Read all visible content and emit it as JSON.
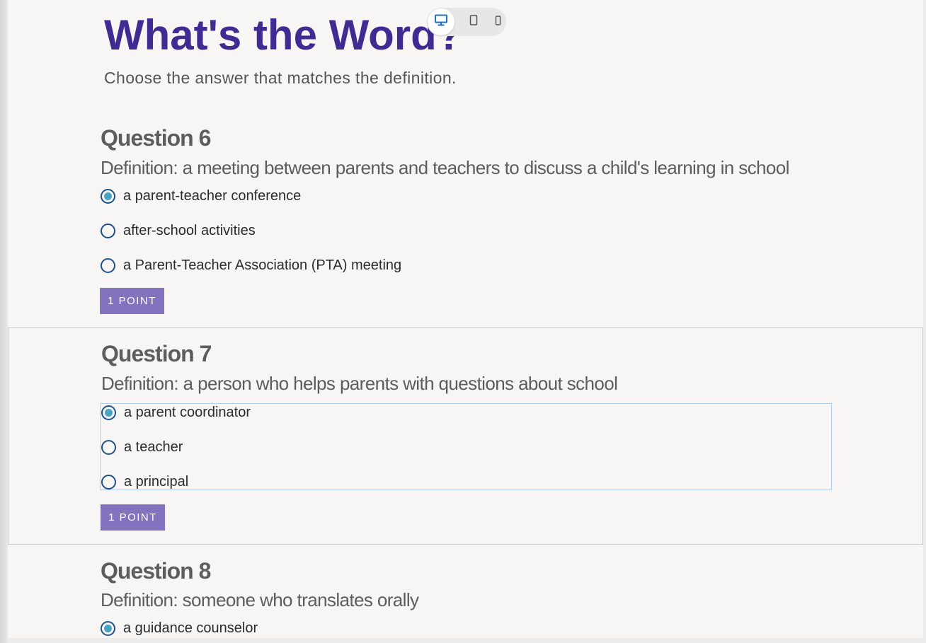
{
  "page": {
    "title": "What's the Word?",
    "subtitle": "Choose the answer that matches the definition."
  },
  "device_toggle": [
    {
      "name": "desktop-icon",
      "active": true
    },
    {
      "name": "tablet-icon",
      "active": false
    },
    {
      "name": "phone-icon",
      "active": false
    }
  ],
  "colors": {
    "title": "#3f2b92",
    "points_badge": "#8373be",
    "radio_border": "#1d5189",
    "radio_fill": "#49a3c4",
    "selection_border": "#b5cdee"
  },
  "questions": [
    {
      "heading": "Question 6",
      "definition": "Definition: a meeting between parents and teachers to discuss a child's learning in school",
      "options": [
        {
          "label": "a parent-teacher conference",
          "selected": true
        },
        {
          "label": "after-school activities",
          "selected": false
        },
        {
          "label": "a Parent-Teacher Association (PTA) meeting",
          "selected": false
        }
      ],
      "points": "1 POINT"
    },
    {
      "heading": "Question 7",
      "definition": "Definition: a person who helps parents with questions about school",
      "options": [
        {
          "label": "a parent coordinator",
          "selected": true
        },
        {
          "label": "a teacher",
          "selected": false
        },
        {
          "label": "a principal",
          "selected": false
        }
      ],
      "points": "1 POINT"
    },
    {
      "heading": "Question 8",
      "definition": "Definition: someone who translates orally",
      "options": [
        {
          "label": "a guidance counselor",
          "selected": true
        }
      ]
    }
  ]
}
